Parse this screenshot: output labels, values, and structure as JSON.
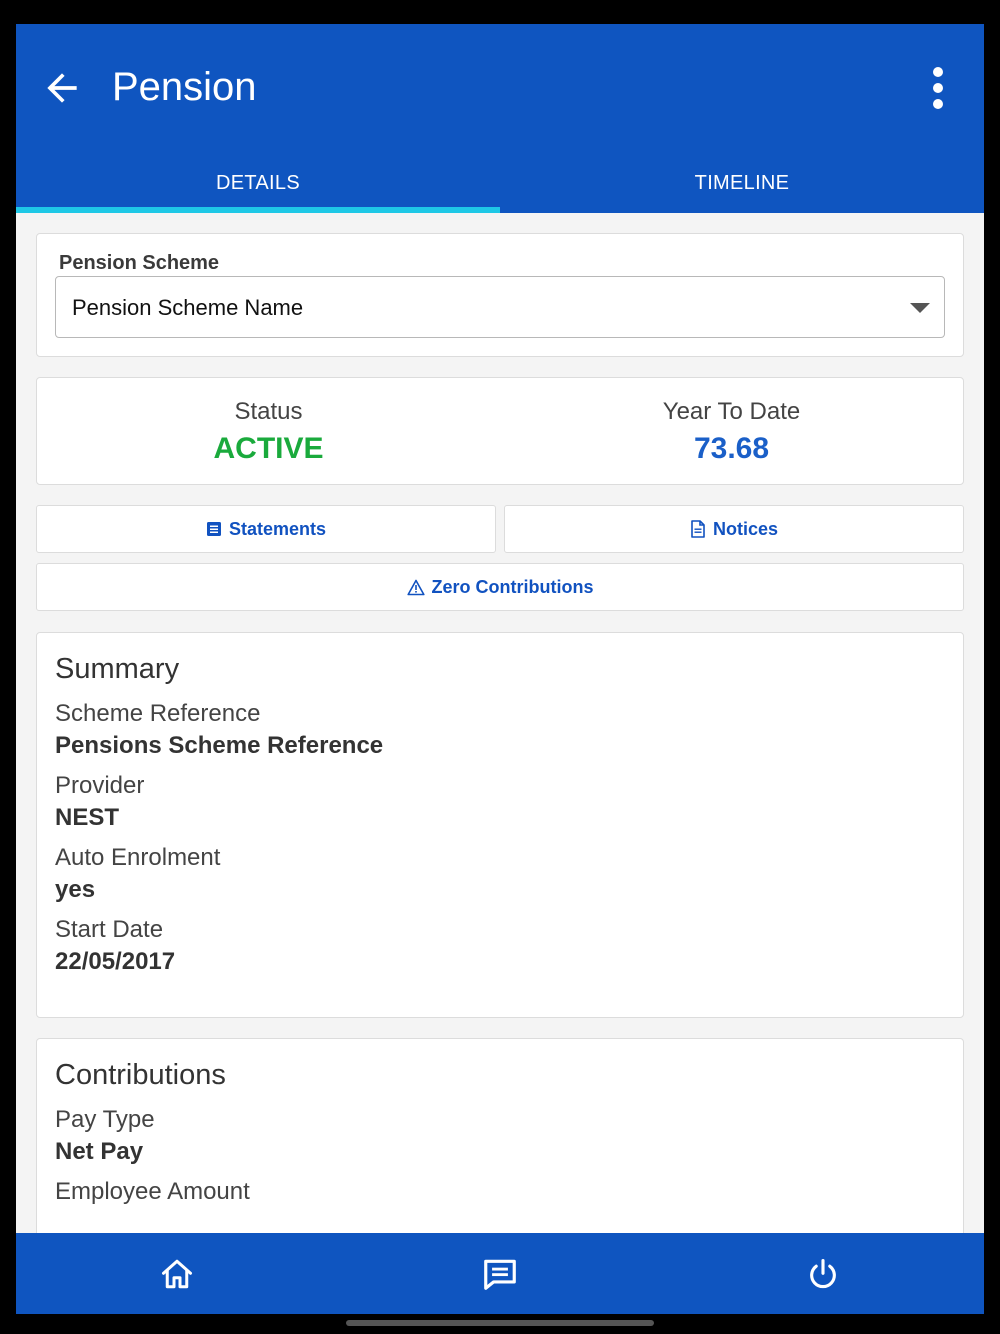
{
  "header": {
    "title": "Pension",
    "back_icon": "arrow-left-icon",
    "menu_icon": "more-vertical-icon"
  },
  "tabs": [
    {
      "label": "DETAILS",
      "active": true
    },
    {
      "label": "TIMELINE",
      "active": false
    }
  ],
  "scheme": {
    "label": "Pension Scheme",
    "selected": "Pension Scheme Name"
  },
  "stats": {
    "status_label": "Status",
    "status_value": "ACTIVE",
    "ytd_label": "Year To Date",
    "ytd_value": "73.68"
  },
  "actions": {
    "statements": "Statements",
    "notices": "Notices",
    "zero_contributions": "Zero Contributions"
  },
  "summary": {
    "title": "Summary",
    "items": [
      {
        "label": "Scheme Reference",
        "value": "Pensions Scheme Reference"
      },
      {
        "label": "Provider",
        "value": "NEST"
      },
      {
        "label": "Auto Enrolment",
        "value": "yes"
      },
      {
        "label": "Start Date",
        "value": "22/05/2017"
      }
    ]
  },
  "contributions": {
    "title": "Contributions",
    "items": [
      {
        "label": "Pay Type",
        "value": "Net Pay"
      },
      {
        "label": "Employee Amount",
        "value": ""
      }
    ]
  },
  "bottom_nav": {
    "home_icon": "home-icon",
    "messages_icon": "message-icon",
    "power_icon": "power-icon"
  },
  "colors": {
    "primary": "#0f55c0",
    "tab_indicator": "#1ec8e6",
    "status_active": "#1aaa3c",
    "ytd_value": "#1a5fc8",
    "link": "#1152c0"
  }
}
